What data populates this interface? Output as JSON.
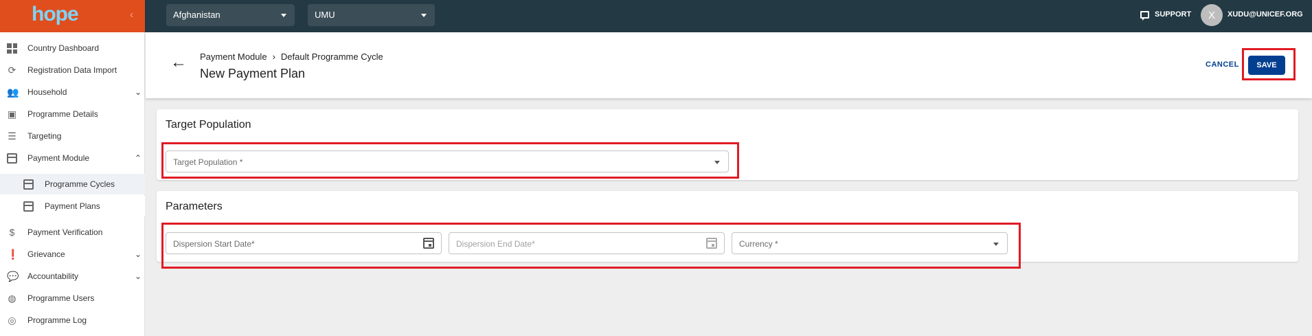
{
  "topbar": {
    "logo": "hope",
    "country_select": "Afghanistan",
    "programme_select": "UMU",
    "support_label": "SUPPORT",
    "avatar_initial": "X",
    "user_email": "XUDU@UNICEF.ORG"
  },
  "sidebar": {
    "items": [
      {
        "label": "Country Dashboard"
      },
      {
        "label": "Registration Data Import"
      },
      {
        "label": "Household"
      },
      {
        "label": "Programme Details"
      },
      {
        "label": "Targeting"
      },
      {
        "label": "Payment Module"
      },
      {
        "label": "Programme Cycles"
      },
      {
        "label": "Payment Plans"
      },
      {
        "label": "Payment Verification"
      },
      {
        "label": "Grievance"
      },
      {
        "label": "Accountability"
      },
      {
        "label": "Programme Users"
      },
      {
        "label": "Programme Log"
      }
    ]
  },
  "header": {
    "breadcrumb_parent": "Payment Module",
    "breadcrumb_child": "Default Programme Cycle",
    "title": "New Payment Plan",
    "cancel_label": "CANCEL",
    "save_label": "SAVE"
  },
  "target_panel": {
    "title": "Target Population",
    "target_placeholder": "Target Population *"
  },
  "parameters_panel": {
    "title": "Parameters",
    "start_date_placeholder": "Dispersion Start Date*",
    "end_date_placeholder": "Dispersion End Date*",
    "currency_placeholder": "Currency *"
  },
  "colors": {
    "topbar": "#233944",
    "logo_bg": "#e04e1d",
    "primary": "#033f91",
    "highlight": "#e01b24"
  }
}
